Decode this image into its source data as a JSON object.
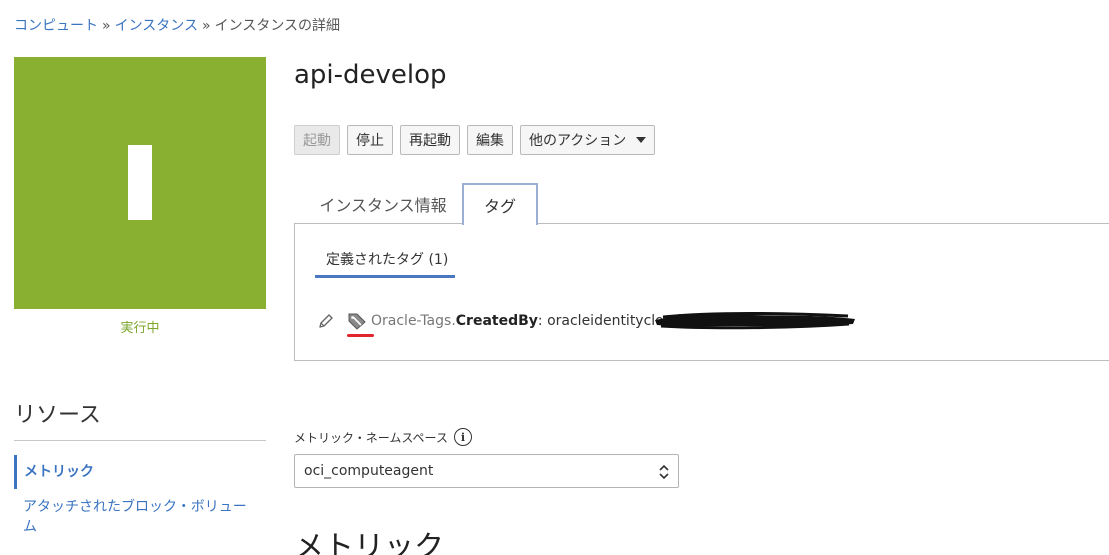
{
  "breadcrumb": {
    "items": [
      "コンピュート",
      "インスタンス"
    ],
    "separator": "»",
    "current": "インスタンスの詳細"
  },
  "instance": {
    "badge_letter": "I",
    "badge_color": "#8ab032",
    "status": "実行中",
    "name": "api-develop"
  },
  "actions": {
    "start": "起動",
    "stop": "停止",
    "reboot": "再起動",
    "edit": "編集",
    "more": "他のアクション"
  },
  "tabs": {
    "info": "インスタンス情報",
    "tags": "タグ"
  },
  "tags_panel": {
    "subtab": "定義されたタグ (1)",
    "tag": {
      "namespace": "Oracle-Tags.",
      "key": "CreatedBy",
      "separator": ":",
      "value": "oracleidentityclouds"
    }
  },
  "resources": {
    "title": "リソース",
    "items": [
      "メトリック",
      "アタッチされたブロック・ボリューム"
    ]
  },
  "metrics": {
    "namespace_label": "メトリック・ネームスペース",
    "namespace_value": "oci_computeagent",
    "heading": "メトリック"
  },
  "colors": {
    "link": "#3a74c1",
    "status": "#7da62e",
    "highlight": "#e0252b"
  }
}
